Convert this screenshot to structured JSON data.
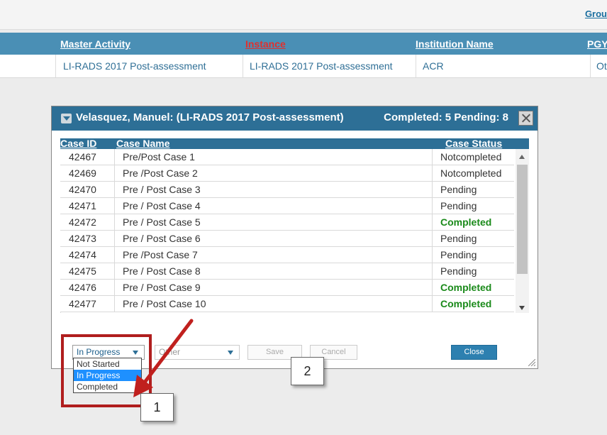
{
  "topbar": {
    "group_link": "Grou"
  },
  "main_table": {
    "headers": {
      "master_activity": "Master Activity",
      "instance": "Instance",
      "institution_name": "Institution Name",
      "pgy": "PGY"
    },
    "row": {
      "master_activity": "LI-RADS 2017 Post-assessment",
      "instance": "LI-RADS 2017 Post-assessment",
      "institution_name": "ACR",
      "pgy": "Ot"
    }
  },
  "modal": {
    "title": "Velasquez, Manuel: (LI-RADS 2017 Post-assessment)",
    "stats": "Completed: 5 Pending: 8",
    "columns": {
      "case_id": "Case ID",
      "case_name": "Case Name",
      "case_status": "Case Status"
    },
    "rows": [
      {
        "id": "42467",
        "name": "Pre/Post Case 1",
        "status": "Notcompleted"
      },
      {
        "id": "42469",
        "name": "Pre /Post Case 2",
        "status": "Notcompleted"
      },
      {
        "id": "42470",
        "name": "Pre / Post Case 3",
        "status": "Pending"
      },
      {
        "id": "42471",
        "name": "Pre / Post Case 4",
        "status": "Pending"
      },
      {
        "id": "42472",
        "name": "Pre / Post Case 5",
        "status": "Completed"
      },
      {
        "id": "42473",
        "name": "Pre / Post Case 6",
        "status": "Pending"
      },
      {
        "id": "42474",
        "name": "Pre /Post Case 7",
        "status": "Pending"
      },
      {
        "id": "42475",
        "name": "Pre / Post Case 8",
        "status": "Pending"
      },
      {
        "id": "42476",
        "name": "Pre / Post Case 9",
        "status": "Completed"
      },
      {
        "id": "42477",
        "name": "Pre / Post Case 10",
        "status": "Completed"
      }
    ],
    "status_select": {
      "value": "In Progress",
      "options": [
        "Not Started",
        "In Progress",
        "Completed"
      ]
    },
    "other_select": {
      "value": "Other"
    },
    "save_label": "Save",
    "cancel_label": "Cancel",
    "close_label": "Close"
  },
  "annotations": {
    "callout_1": "1",
    "callout_2": "2"
  },
  "colors": {
    "header_blue": "#2d6f96",
    "completed_green": "#1a8a1a",
    "annotation_red": "#b01e1e"
  }
}
